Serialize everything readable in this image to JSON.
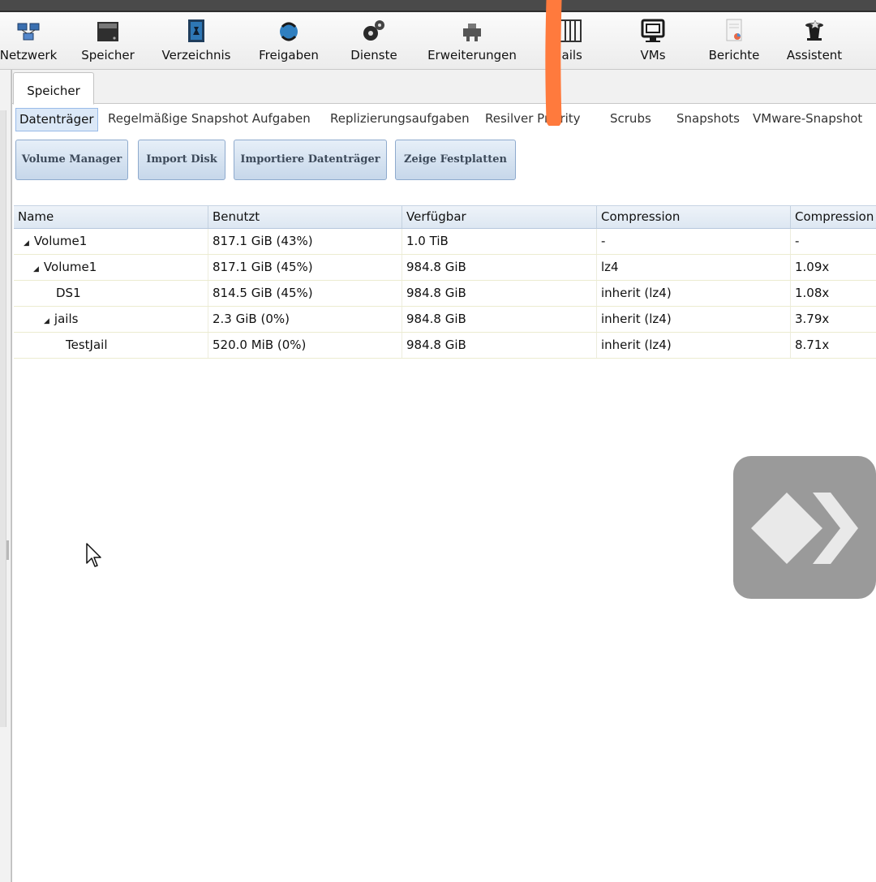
{
  "toolbar": {
    "items": [
      {
        "label": "Netzwerk",
        "icon": "network-icon"
      },
      {
        "label": "Speicher",
        "icon": "storage-icon"
      },
      {
        "label": "Verzeichnis",
        "icon": "directory-icon"
      },
      {
        "label": "Freigaben",
        "icon": "sharing-icon"
      },
      {
        "label": "Dienste",
        "icon": "services-icon"
      },
      {
        "label": "Erweiterungen",
        "icon": "plugins-icon"
      },
      {
        "label": "Jails",
        "icon": "jails-icon"
      },
      {
        "label": "VMs",
        "icon": "vms-icon"
      },
      {
        "label": "Berichte",
        "icon": "reports-icon"
      },
      {
        "label": "Assistent",
        "icon": "wizard-icon"
      }
    ]
  },
  "main_tab": {
    "label": "Speicher"
  },
  "subtabs": [
    {
      "label": "Datenträger"
    },
    {
      "label": "Regelmäßige Snapshot Aufgaben"
    },
    {
      "label": "Replizierungsaufgaben"
    },
    {
      "label": "Resilver Priority"
    },
    {
      "label": "Scrubs"
    },
    {
      "label": "Snapshots"
    },
    {
      "label": "VMware-Snapshot"
    }
  ],
  "buttons": {
    "volume_manager": "Volume Manager",
    "import_disk": "Import Disk",
    "import_volume": "Importiere Datenträger",
    "view_disks": "Zeige Festplatten"
  },
  "table": {
    "columns": [
      "Name",
      "Benutzt",
      "Verfügbar",
      "Compression",
      "Compression Ratio"
    ],
    "rows": [
      {
        "name": "Volume1",
        "used": "817.1 GiB (43%)",
        "available": "1.0 TiB",
        "compression": "-",
        "ratio": "-"
      },
      {
        "name": "Volume1",
        "used": "817.1 GiB (45%)",
        "available": "984.8 GiB",
        "compression": "lz4",
        "ratio": "1.09x"
      },
      {
        "name": "DS1",
        "used": "814.5 GiB (45%)",
        "available": "984.8 GiB",
        "compression": "inherit (lz4)",
        "ratio": "1.08x"
      },
      {
        "name": "jails",
        "used": "2.3 GiB (0%)",
        "available": "984.8 GiB",
        "compression": "inherit (lz4)",
        "ratio": "3.79x"
      },
      {
        "name": "TestJail",
        "used": "520.0 MiB (0%)",
        "available": "984.8 GiB",
        "compression": "inherit (lz4)",
        "ratio": "8.71x"
      }
    ]
  },
  "colors": {
    "annotation_stroke": "#ff7a3d",
    "remote_overlay": "#9a9a9a",
    "button_border": "#8eaacd",
    "active_subtab": "#dbe8f7"
  }
}
